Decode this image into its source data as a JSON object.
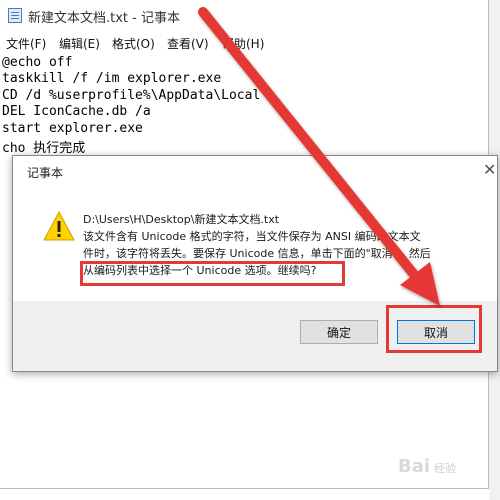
{
  "window": {
    "title": "新建文本文档.txt - 记事本",
    "menu": [
      "文件(F)",
      "编辑(E)",
      "格式(O)",
      "查看(V)",
      "帮助(H)"
    ]
  },
  "editor": {
    "lines": [
      "@echo off",
      "taskkill /f /im explorer.exe",
      "CD /d %userprofile%\\AppData\\Local",
      "DEL IconCache.db /a",
      "start explorer.exe",
      "cho 执行完成"
    ]
  },
  "dialog": {
    "title": "记事本",
    "close_glyph": "✕",
    "message_lines": [
      "D:\\Users\\H\\Desktop\\新建文本文档.txt",
      "该文件含有 Unicode 格式的字符，当文件保存为 ANSI 编码的文本文",
      "件时，该字符将丢失。要保存 Unicode 信息，单击下面的\"取消\"，然后",
      "从编码列表中选择一个 Unicode 选项。继续吗?"
    ],
    "ok_label": "确定",
    "cancel_label": "取消",
    "warning_icon": "warning-triangle-icon"
  },
  "annotation": {
    "color": "#e53935"
  },
  "watermark": {
    "text": "Bai",
    "suffix": "经验"
  }
}
